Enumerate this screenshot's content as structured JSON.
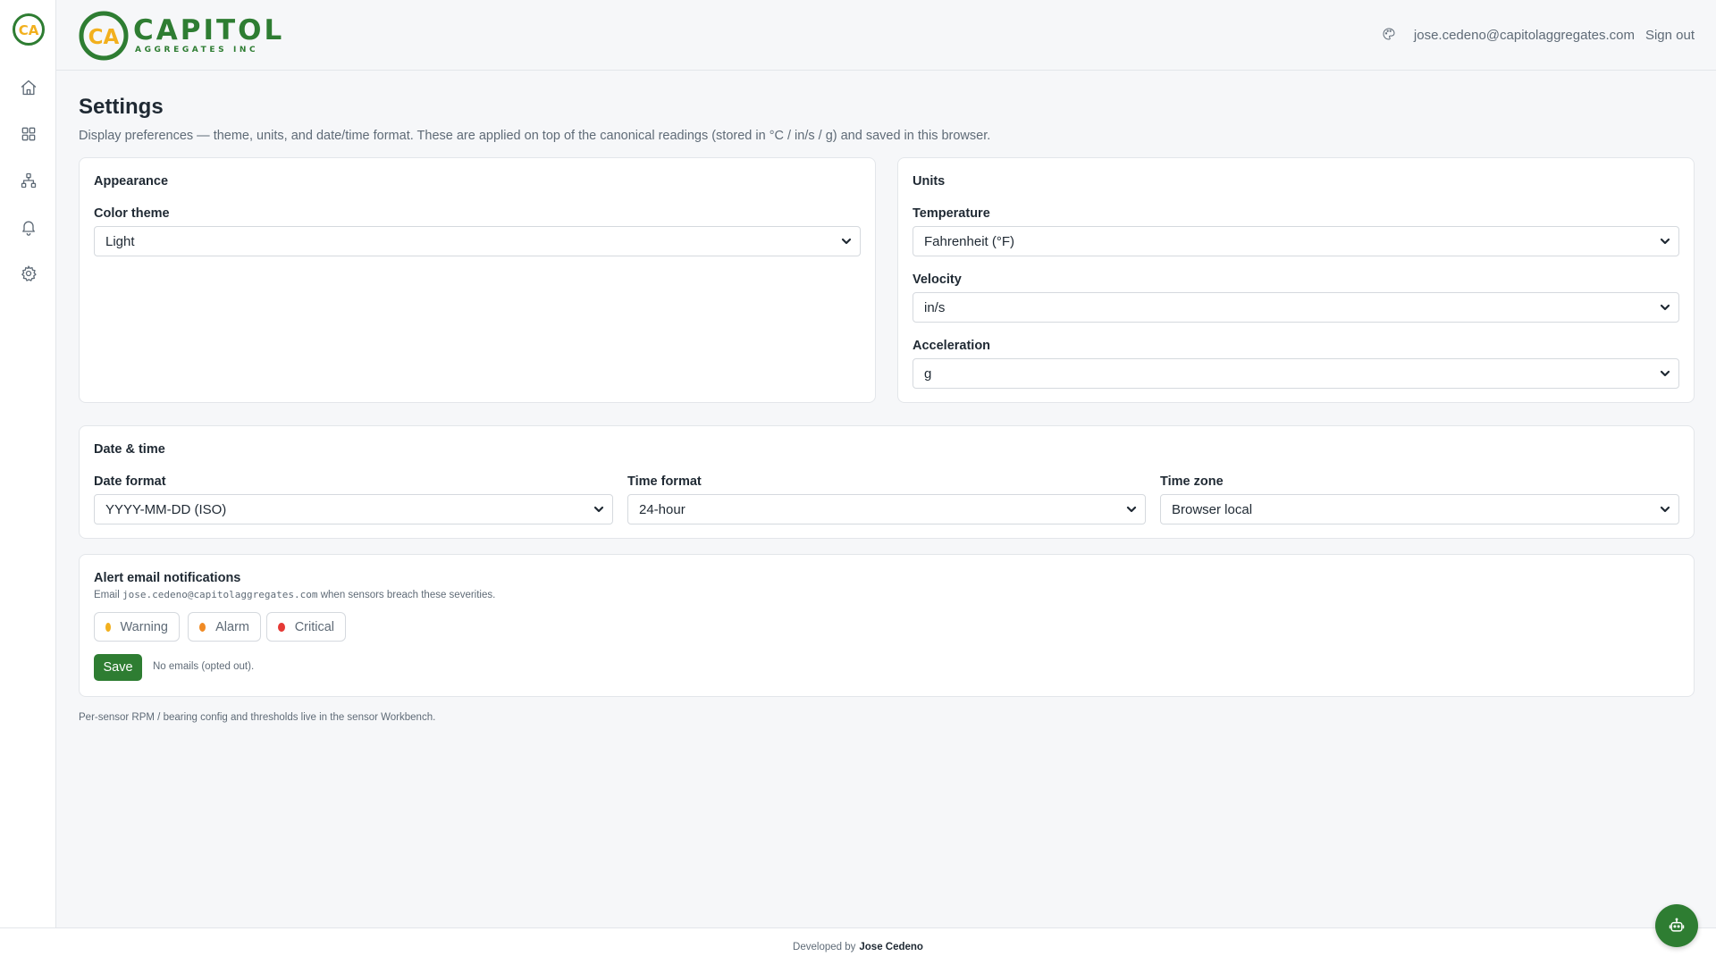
{
  "brand": {
    "name": "CAPITOL",
    "sub": "AGGREGATES INC",
    "logo_letters": "CA"
  },
  "sidebar": {
    "items": [
      {
        "name": "home",
        "icon": "home-icon"
      },
      {
        "name": "dashboard",
        "icon": "grid-icon"
      },
      {
        "name": "hierarchy",
        "icon": "sitemap-icon"
      },
      {
        "name": "alerts",
        "icon": "bell-icon"
      },
      {
        "name": "settings",
        "icon": "gear-icon"
      }
    ]
  },
  "header": {
    "user_email": "jose.cedeno@capitolaggregates.com",
    "sign_out": "Sign out"
  },
  "page": {
    "title": "Settings",
    "description": "Display preferences — theme, units, and date/time format. These are applied on top of the canonical readings (stored in °C / in/s / g) and saved in this browser."
  },
  "appearance": {
    "title": "Appearance",
    "color_theme_label": "Color theme",
    "color_theme_value": "Light"
  },
  "units": {
    "title": "Units",
    "temperature_label": "Temperature",
    "temperature_value": "Fahrenheit (°F)",
    "velocity_label": "Velocity",
    "velocity_value": "in/s",
    "acceleration_label": "Acceleration",
    "acceleration_value": "g"
  },
  "datetime": {
    "title": "Date & time",
    "date_format_label": "Date format",
    "date_format_value": "YYYY-MM-DD (ISO)",
    "time_format_label": "Time format",
    "time_format_value": "24-hour",
    "time_zone_label": "Time zone",
    "time_zone_value": "Browser local"
  },
  "alerts": {
    "title": "Alert email notifications",
    "desc_prefix": "Email",
    "desc_email": "jose.cedeno@capitolaggregates.com",
    "desc_suffix": "when sensors breach these severities.",
    "severities": [
      {
        "label": "Warning",
        "color": "#f2b01e"
      },
      {
        "label": "Alarm",
        "color": "#f08a24"
      },
      {
        "label": "Critical",
        "color": "#e53935"
      }
    ],
    "save_label": "Save",
    "status": "No emails (opted out)."
  },
  "footnote": "Per-sensor RPM / bearing config and thresholds live in the sensor Workbench.",
  "footer": {
    "prefix": "Developed by",
    "name": "Jose Cedeno"
  },
  "colors": {
    "brand_green": "#2e7d32",
    "brand_yellow": "#f2b01e"
  }
}
